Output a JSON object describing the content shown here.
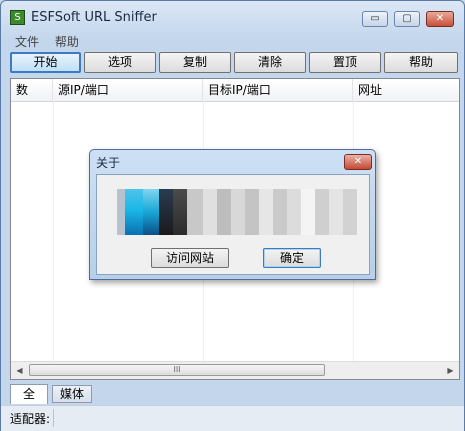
{
  "window": {
    "title": "ESFSoft URL Sniffer",
    "controls": {
      "minimize": "▭",
      "maximize": "▢",
      "close": "✕"
    }
  },
  "menu": [
    "文件",
    "帮助"
  ],
  "toolbar": {
    "start": "开始",
    "options": "选项",
    "copy": "复制",
    "clear": "清除",
    "pin": "置顶",
    "help": "帮助"
  },
  "table": {
    "columns": [
      "数",
      "源IP/端口",
      "目标IP/端口",
      "网址"
    ]
  },
  "scrollbar": {
    "left_arrow": "◀",
    "right_arrow": "▶",
    "thumb_grip": "III"
  },
  "tabs": [
    "全",
    "媒体"
  ],
  "status": {
    "adapter_label": "适配器:"
  },
  "dialog": {
    "title": "关于",
    "visit_site": "访问网站",
    "ok": "确定"
  },
  "colors": {
    "accent": "#3d7bc0",
    "pixel_cyan": "#19b8e6",
    "pixel_blue": "#0a6fb0",
    "pixel_dark": "#1a1a1a"
  }
}
